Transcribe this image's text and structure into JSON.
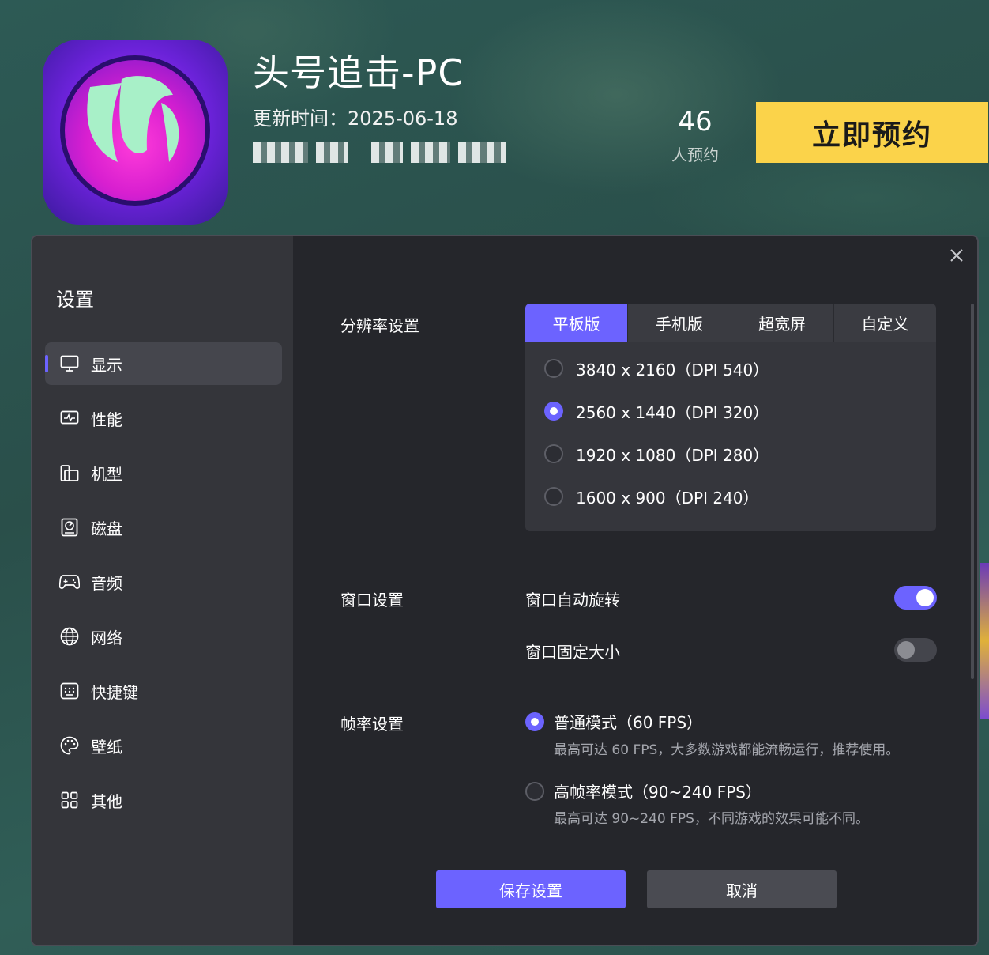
{
  "header": {
    "title": "头号追击-PC",
    "update_time": "更新时间：2025-06-18",
    "reservation_count": "46",
    "reservation_label": "人预约",
    "reserve_button": "立即预约"
  },
  "settings": {
    "title": "设置",
    "nav": [
      {
        "label": "显示",
        "icon": "monitor-icon"
      },
      {
        "label": "性能",
        "icon": "performance-icon"
      },
      {
        "label": "机型",
        "icon": "device-model-icon"
      },
      {
        "label": "磁盘",
        "icon": "disk-icon"
      },
      {
        "label": "音频",
        "icon": "gamepad-icon"
      },
      {
        "label": "网络",
        "icon": "globe-icon"
      },
      {
        "label": "快捷键",
        "icon": "keyboard-icon"
      },
      {
        "label": "壁纸",
        "icon": "palette-icon"
      },
      {
        "label": "其他",
        "icon": "grid-icon"
      }
    ],
    "active_nav": "显示",
    "resolution": {
      "label": "分辨率设置",
      "tabs": [
        "平板版",
        "手机版",
        "超宽屏",
        "自定义"
      ],
      "active_tab": "平板版",
      "options": [
        {
          "text": "3840 x 2160（DPI 540）",
          "selected": false
        },
        {
          "text": "2560 x 1440（DPI 320）",
          "selected": true
        },
        {
          "text": "1920 x 1080（DPI 280）",
          "selected": false
        },
        {
          "text": "1600 x 900（DPI 240）",
          "selected": false
        }
      ]
    },
    "window": {
      "label": "窗口设置",
      "auto_rotate": {
        "label": "窗口自动旋转",
        "on": true
      },
      "fixed_size": {
        "label": "窗口固定大小",
        "on": false
      }
    },
    "framerate": {
      "label": "帧率设置",
      "normal": {
        "title": "普通模式（60 FPS）",
        "desc": "最高可达 60 FPS，大多数游戏都能流畅运行，推荐使用。",
        "selected": true
      },
      "high": {
        "title": "高帧率模式（90~240 FPS）",
        "desc": "最高可达 90~240 FPS，不同游戏的效果可能不同。",
        "selected": false
      }
    },
    "save_button": "保存设置",
    "cancel_button": "取消"
  },
  "colors": {
    "accent": "#6c63ff",
    "reserve_yellow": "#fbd34a",
    "dialog_bg": "#25262b",
    "sidebar_bg": "#34353a"
  }
}
